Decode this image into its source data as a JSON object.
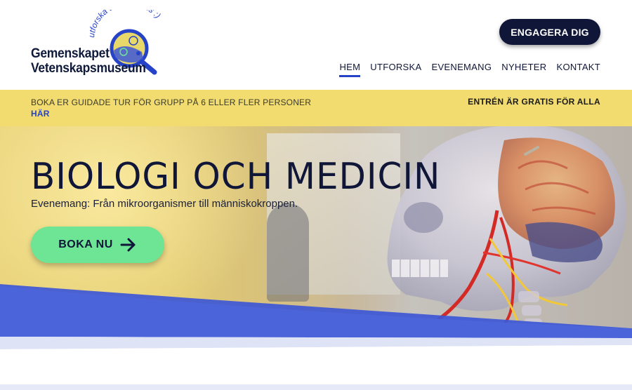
{
  "logo": {
    "tagline": "utforska tillsammans :)",
    "name_line1": "Gemenskapet",
    "name_line2": "Vetenskapsmuseum"
  },
  "header": {
    "cta_label": "ENGAGERA DIG"
  },
  "nav": {
    "items": [
      {
        "label": "HEM",
        "active": true
      },
      {
        "label": "UTFORSKA",
        "active": false
      },
      {
        "label": "EVENEMANG",
        "active": false
      },
      {
        "label": "NYHETER",
        "active": false
      },
      {
        "label": "KONTAKT",
        "active": false
      }
    ]
  },
  "infobar": {
    "left_text": "BOKA ER GUIDADE TUR FÖR GRUPP PÅ 6 ELLER FLER PERSONER",
    "left_link": "HÄR",
    "right_text": "ENTRÉN ÄR GRATIS FÖR ALLA"
  },
  "hero": {
    "title": "BIOLOGI OCH MEDICIN",
    "subtitle": "Evenemang: Från mikroorganismer till människokroppen.",
    "button_label": "BOKA NU"
  },
  "colors": {
    "navy": "#101638",
    "accent_blue": "#2643c8",
    "info_yellow": "#f2dc6f",
    "button_green": "#6ee595",
    "wave_blue": "#3d57d6"
  },
  "icons": {
    "logo_magnifier": "magnifier-icon",
    "hero_button_arrow": "arrow-right-icon"
  }
}
